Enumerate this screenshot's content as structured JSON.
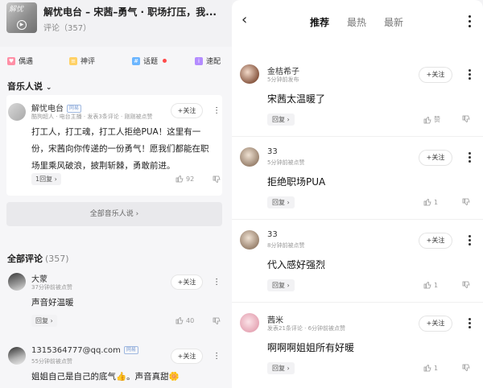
{
  "left": {
    "header": {
      "cover_text": "解忧",
      "title": "解忧电台 – 宋茜–勇气 · 职场打压，我...",
      "subtitle": "评论（357）"
    },
    "quick_tabs": [
      {
        "label": "偶遇",
        "icon": "heart-icon",
        "color": "#ff6b8a"
      },
      {
        "label": "神评",
        "icon": "sparkle-icon",
        "color": "#ffc93c"
      },
      {
        "label": "话题",
        "icon": "topic-icon",
        "color": "#4aa3ff"
      },
      {
        "label": "速配",
        "icon": "match-icon",
        "color": "#a66bff"
      }
    ],
    "music_section": {
      "title": "音乐人说"
    },
    "music_comment": {
      "name": "解忧电台",
      "tag": "网易",
      "meta": "酷狗超人 · 电台主播 · 发表3条评论 · 刚刚被点赞",
      "follow_label": "+关注",
      "text_lines": [
        "打工人，打工魂，打工人拒绝PUA！这里有一",
        "份，宋茜向你传递的一份勇气！愿我们都能在职",
        "场里乘风破浪，披荆斩棘，勇敢前进。"
      ],
      "reply_label": "1回复 ›",
      "likes": "92"
    },
    "all_music_label": "全部音乐人说 ›",
    "all_comments": {
      "title": "全部评论",
      "count": "(357)"
    },
    "comments": [
      {
        "name": "大蒙",
        "meta": "37分钟前被点赞",
        "follow_label": "+关注",
        "text": "声音好温暖",
        "reply_label": "回复 ›",
        "likes": "40"
      },
      {
        "name": "1315364777@qq.com",
        "tag": "网易",
        "meta": "55分钟前被点赞",
        "follow_label": "+关注",
        "text": "姐姐自己是自己的底气👍。声音真甜🌼"
      }
    ]
  },
  "right": {
    "tabs": [
      {
        "label": "推荐",
        "active": true
      },
      {
        "label": "最热",
        "active": false
      },
      {
        "label": "最新",
        "active": false
      }
    ],
    "comments": [
      {
        "name": "金桔希子",
        "meta": "5分钟前发布",
        "follow_label": "+关注",
        "text": "宋茜太温暖了",
        "reply_label": "回复 ›",
        "likes": "赞"
      },
      {
        "name": "33",
        "meta": "5分钟前被点赞",
        "follow_label": "+关注",
        "text": "拒绝职场PUA",
        "reply_label": "回复 ›",
        "likes": "1"
      },
      {
        "name": "33",
        "meta": "8分钟前被点赞",
        "follow_label": "+关注",
        "text": "代入感好强烈",
        "reply_label": "回复 ›",
        "likes": "1"
      },
      {
        "name": "茜米",
        "meta": "发表21条评论 · 6分钟前被点赞",
        "follow_label": "+关注",
        "text": "啊啊啊姐姐所有好暖",
        "reply_label": "回复 ›",
        "likes": "1"
      }
    ]
  },
  "colors": {
    "accent_red": "#ff4a4a",
    "tag_blue": "#7fa0d6",
    "panel_bg": "#f6f6f8"
  }
}
